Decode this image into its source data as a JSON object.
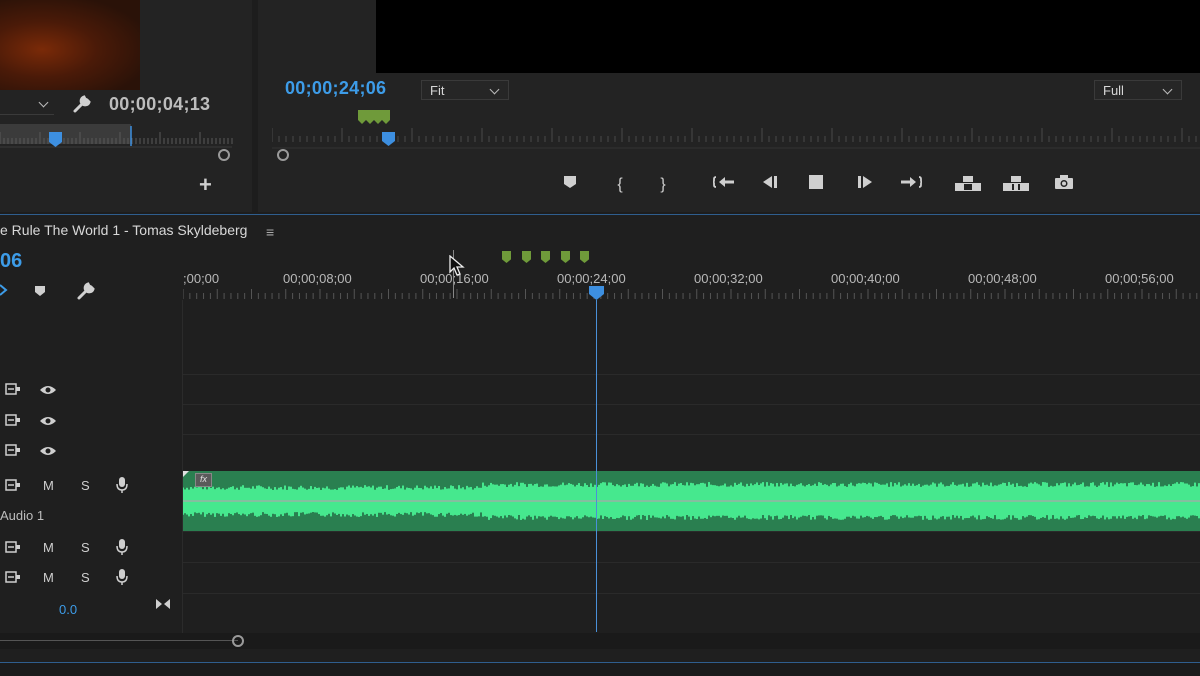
{
  "source_monitor": {
    "timecode": "00;00;04;13",
    "dropdown_value": "",
    "add_label": "+"
  },
  "program_monitor": {
    "timecode": "00;00;24;06",
    "zoom_value": "Fit",
    "quality_value": "Full"
  },
  "timeline": {
    "sequence_title": "e Rule The World 1 - Tomas Skyldeberg",
    "menu_glyph": "≡",
    "timecode_fragment": "06",
    "ruler_labels": [
      ";00;00",
      "00;00;08;00",
      "00;00;16;00",
      "00;00;24;00",
      "00;00;32;00",
      "00;00;40;00",
      "00;00;48;00",
      "00;00;56;00"
    ],
    "tracks": {
      "audio_track_name": "Audio 1",
      "mute_label": "M",
      "solo_label": "S",
      "master_volume": "0.0",
      "fx_badge": "fx"
    }
  },
  "colors": {
    "accent_blue": "#3d9ce8",
    "waveform": "#46e88e",
    "clip_bg": "#2a7f50",
    "marker_green": "#6f9a3a"
  },
  "icons": [
    "wrench-icon",
    "add-icon",
    "marker-icon",
    "mark-in-icon",
    "mark-out-icon",
    "go-to-in-icon",
    "step-back-icon",
    "stop-icon",
    "play-icon",
    "go-to-out-icon",
    "lift-icon",
    "extract-icon",
    "camera-icon",
    "snap-icon",
    "eye-icon",
    "microphone-icon",
    "toggle-track-output-icon"
  ]
}
